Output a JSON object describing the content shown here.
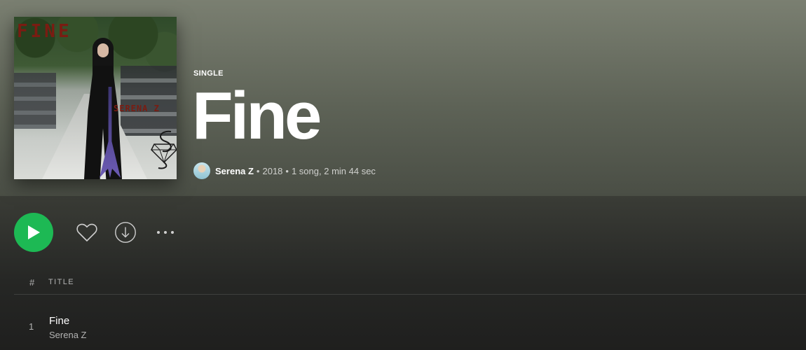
{
  "album": {
    "type_label": "SINGLE",
    "title": "Fine",
    "cover": {
      "title_text": "FINE",
      "artist_text": "SERENA Z",
      "logo_icon": "diamond-s-logo-icon"
    }
  },
  "meta": {
    "artist": "Serena Z",
    "separator": "•",
    "year": "2018",
    "summary": "1 song, 2 min 44 sec"
  },
  "actions": {
    "play_icon": "play-icon",
    "like_icon": "heart-icon",
    "download_icon": "download-circle-icon",
    "more_icon": "more-horizontal-icon"
  },
  "table": {
    "headers": {
      "number": "#",
      "title": "TITLE"
    },
    "tracks": [
      {
        "number": "1",
        "title": "Fine",
        "artist": "Serena Z"
      }
    ]
  },
  "colors": {
    "accent": "#1db954",
    "header_bg": "#6b7064",
    "body_bg": "#1f1f1e",
    "muted_text": "#b3b3b3",
    "cover_text": "#7a1c12"
  }
}
